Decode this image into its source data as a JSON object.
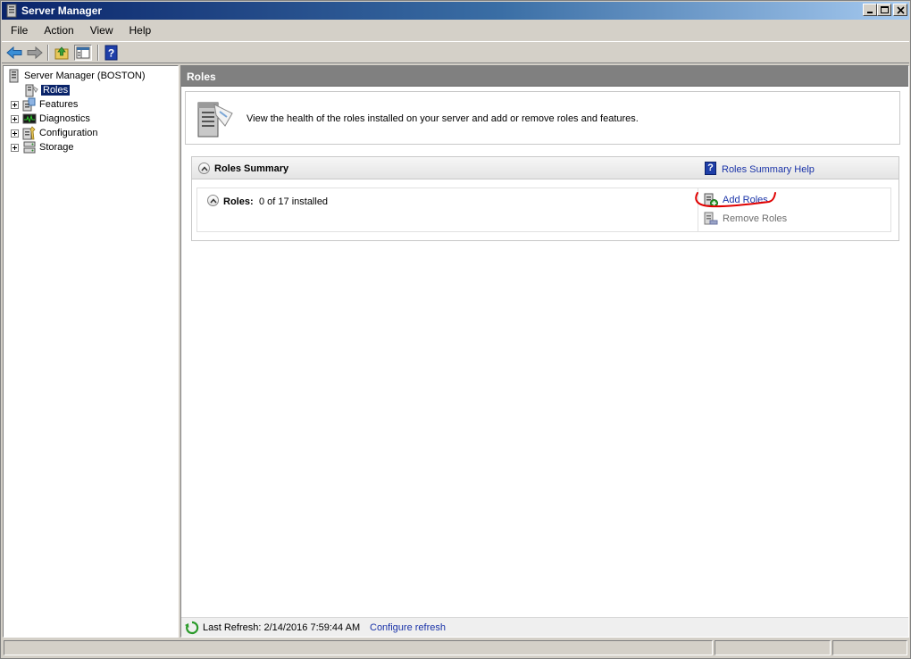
{
  "window": {
    "title": "Server Manager"
  },
  "menu": {
    "items": [
      "File",
      "Action",
      "View",
      "Help"
    ]
  },
  "toolbar": {
    "buttons": [
      "back-icon",
      "forward-icon",
      "up-folder-icon",
      "show-hide-console-tree-icon",
      "help-icon"
    ]
  },
  "tree": {
    "root": "Server Manager (BOSTON)",
    "items": [
      {
        "label": "Roles",
        "selected": true,
        "expandable": false
      },
      {
        "label": "Features",
        "expandable": true
      },
      {
        "label": "Diagnostics",
        "expandable": true
      },
      {
        "label": "Configuration",
        "expandable": true
      },
      {
        "label": "Storage",
        "expandable": true
      }
    ]
  },
  "main": {
    "header": "Roles",
    "description": "View the health of the roles installed on your server and add or remove roles and features.",
    "summary": {
      "title": "Roles Summary",
      "help_link": "Roles Summary Help",
      "roles_label": "Roles:",
      "roles_value": "0 of 17 installed",
      "actions": {
        "add": "Add Roles",
        "remove": "Remove Roles"
      }
    },
    "refresh": {
      "last_refresh": "Last Refresh: 2/14/2016 7:59:44 AM",
      "configure_link": "Configure refresh"
    }
  },
  "colors": {
    "title_bar": "#0a246a",
    "link": "#1a33a8",
    "annotation": "#e00000",
    "selection": "#0a246a"
  }
}
